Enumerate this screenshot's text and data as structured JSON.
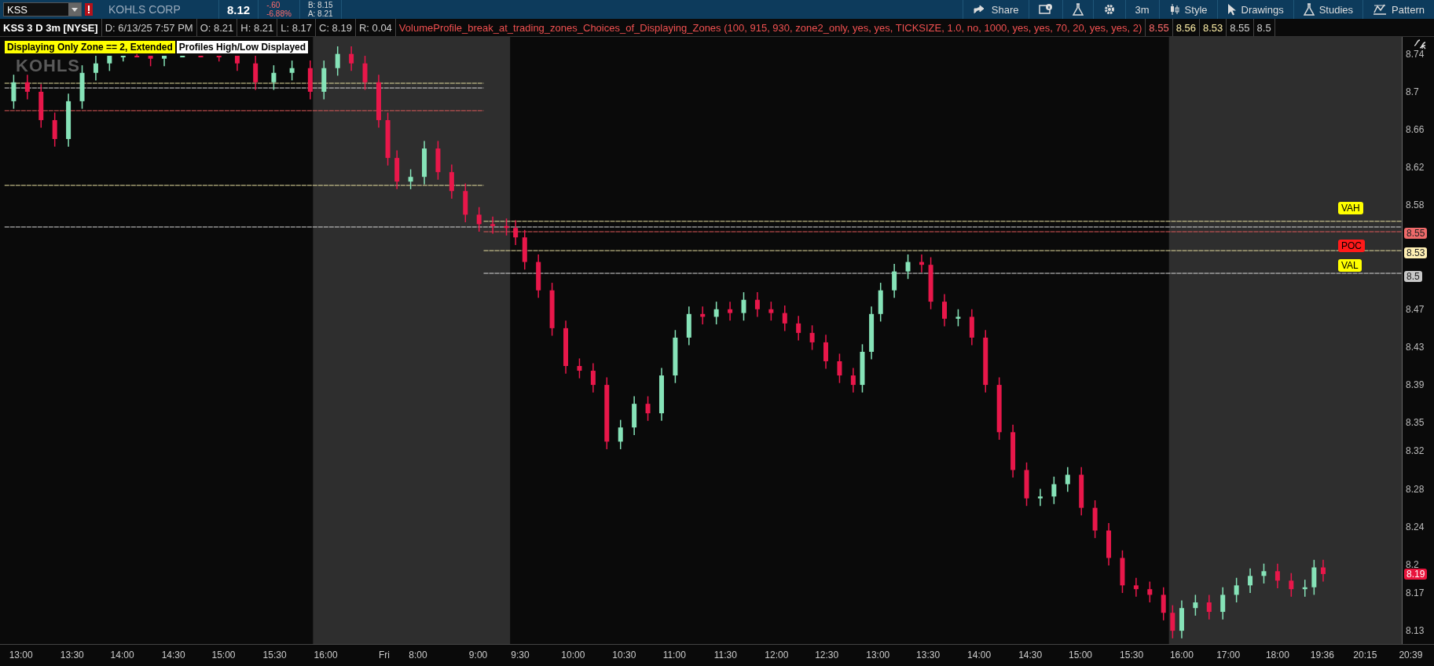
{
  "toolbar": {
    "symbol": "KSS",
    "company": "KOHLS CORP",
    "last": "8.12",
    "change": "-.60",
    "change_pct": "-6.88%",
    "bid": "B: 8.15",
    "ask": "A: 8.21",
    "buttons": [
      {
        "kind": "share",
        "label": "Share"
      },
      {
        "kind": "info"
      },
      {
        "kind": "flask"
      },
      {
        "kind": "gear"
      },
      {
        "kind": "timeframe",
        "label": "3m"
      },
      {
        "kind": "style",
        "label": "Style"
      },
      {
        "kind": "drawings",
        "label": "Drawings"
      },
      {
        "kind": "studies",
        "label": "Studies"
      },
      {
        "kind": "pattern",
        "label": "Pattern"
      }
    ]
  },
  "legend": {
    "chart": "KSS 3 D 3m [NYSE]",
    "fields": [
      "D: 6/13/25 7:57 PM",
      "O: 8.21",
      "H: 8.21",
      "L: 8.17",
      "C: 8.19",
      "R: 0.04"
    ],
    "study": "VolumeProfile_break_at_trading_zones_Choices_of_Displaying_Zones (100, 915, 930, zone2_only, yes, yes, TICKSIZE, 1.0, no, 1000, yes, yes, 70, 20, yes, yes, 2)",
    "study_values": [
      {
        "text": "8.55",
        "kind": "poc"
      },
      {
        "text": "8.56",
        "kind": "vah"
      },
      {
        "text": "8.53",
        "kind": "val"
      },
      {
        "text": "8.55",
        "kind": "high"
      },
      {
        "text": "8.5",
        "kind": "low"
      }
    ]
  },
  "overlays": [
    {
      "text": "Displaying Only Zone == 2, Extended",
      "color": "#ffff00"
    },
    {
      "text": "Profiles High/Low Displayed",
      "color": "#ffffff"
    }
  ],
  "chart_logo": "KOHLS",
  "callouts": [
    {
      "label": "VAH",
      "color": "#ffff00"
    },
    {
      "label": "POC",
      "color": "#ff1a1a"
    },
    {
      "label": "VAL",
      "color": "#ffff00"
    }
  ],
  "price_axis": [
    "8.74",
    "8.7",
    "8.66",
    "8.62",
    "8.58",
    "8.47",
    "8.43",
    "8.39",
    "8.35",
    "8.32",
    "8.28",
    "8.24",
    "8.2",
    "8.17",
    "8.13"
  ],
  "price_badges": [
    {
      "text": "8.55",
      "color": "#f06a6a"
    },
    {
      "text": "8.53",
      "color": "#fff0b4"
    },
    {
      "text": "8.5",
      "color": "#c8c8c8"
    },
    {
      "text": "8.19",
      "color": "#e8143c"
    }
  ],
  "time_axis": [
    "13:00",
    "13:30",
    "14:00",
    "14:30",
    "15:00",
    "15:30",
    "16:00",
    "Fri",
    "8:00",
    "9:00",
    "9:30",
    "10:00",
    "10:30",
    "11:00",
    "11:30",
    "12:00",
    "12:30",
    "13:00",
    "13:30",
    "14:00",
    "14:30",
    "15:00",
    "15:30",
    "16:00",
    "17:00",
    "18:00",
    "19:36",
    "20:15",
    "20:39"
  ]
}
